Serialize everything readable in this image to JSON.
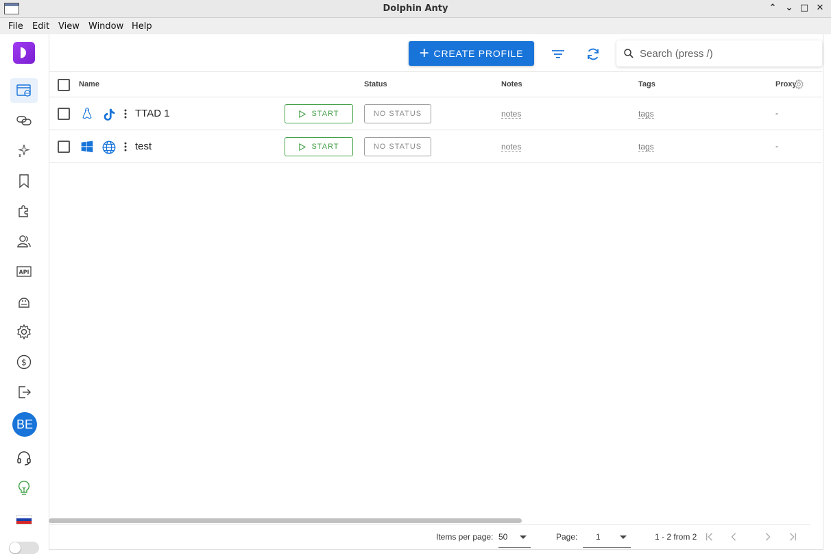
{
  "window": {
    "title": "Dolphin Anty"
  },
  "menu": [
    "File",
    "Edit",
    "View",
    "Window",
    "Help"
  ],
  "sidebar": {
    "avatar_initials": "BE"
  },
  "toolbar": {
    "create_label": "CREATE PROFILE",
    "search_placeholder": "Search (press /)"
  },
  "table": {
    "columns": {
      "name": "Name",
      "status": "Status",
      "notes": "Notes",
      "tags": "Tags",
      "proxy": "Proxy"
    },
    "rows": [
      {
        "name": "TTAD 1",
        "os": "linux-icon",
        "browser": "tiktok-icon",
        "start_label": "START",
        "status": "NO STATUS",
        "notes": "notes",
        "tags": "tags",
        "proxy": "-"
      },
      {
        "name": "test",
        "os": "windows-icon",
        "browser": "globe-icon",
        "start_label": "START",
        "status": "NO STATUS",
        "notes": "notes",
        "tags": "tags",
        "proxy": "-"
      }
    ]
  },
  "pagination": {
    "items_per_page_label": "Items per page:",
    "items_per_page": "50",
    "page_label": "Page:",
    "page": "1",
    "range": "1 - 2 from 2"
  },
  "colors": {
    "accent": "#1874d9",
    "start_green": "#43a047",
    "logo": "#a13bf2"
  }
}
